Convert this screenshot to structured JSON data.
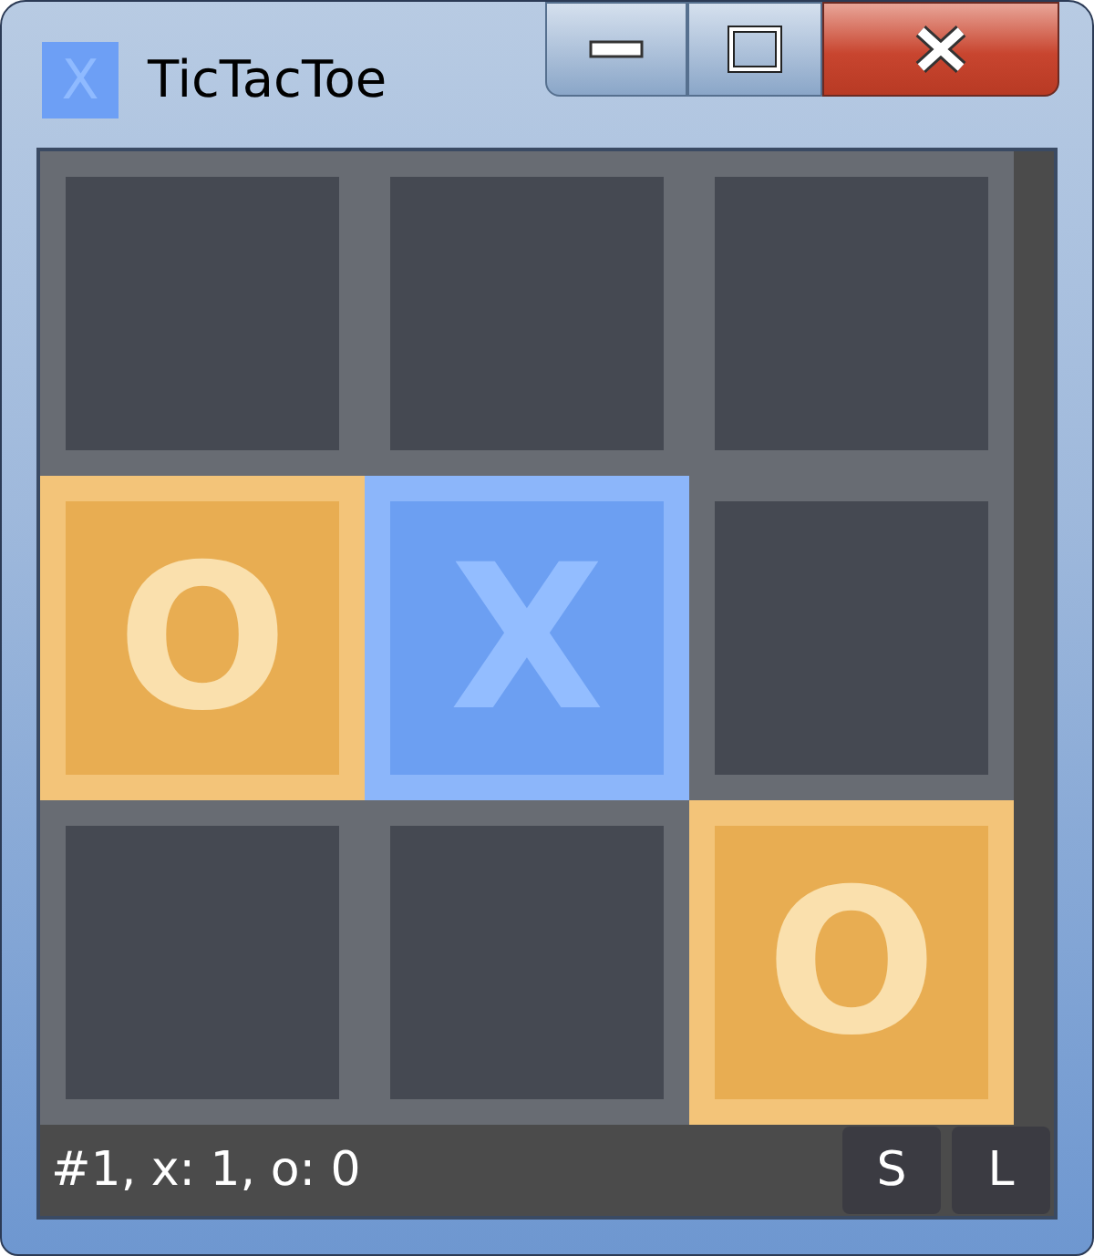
{
  "window": {
    "title": "TicTacToe",
    "icon_letter": "X"
  },
  "board": {
    "cells": [
      {
        "kind": "empty"
      },
      {
        "kind": "empty"
      },
      {
        "kind": "empty"
      },
      {
        "kind": "o",
        "text": "O"
      },
      {
        "kind": "x",
        "text": "X"
      },
      {
        "kind": "empty"
      },
      {
        "kind": "empty"
      },
      {
        "kind": "empty"
      },
      {
        "kind": "o",
        "text": "O"
      }
    ]
  },
  "status_bar": {
    "text": "#1, x: 1, o: 0",
    "buttons": [
      "S",
      "L"
    ]
  }
}
